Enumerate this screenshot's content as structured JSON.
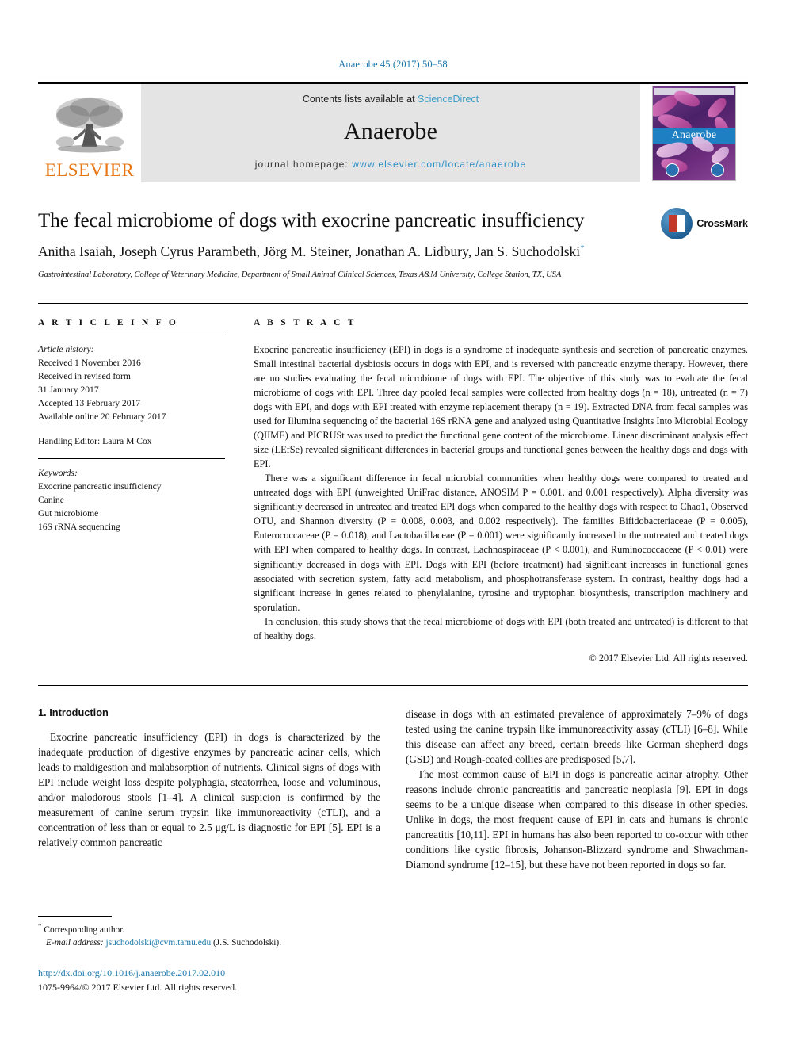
{
  "running_head": "Anaerobe 45 (2017) 50–58",
  "masthead": {
    "publisher_name": "ELSEVIER",
    "publisher_logo_icon": "elsevier-tree-icon",
    "contents_prefix": "Contents lists available at ",
    "contents_link": "ScienceDirect",
    "journal_name": "Anaerobe",
    "homepage_prefix": "journal homepage: ",
    "homepage_url": "www.elsevier.com/locate/anaerobe",
    "cover_title": "Anaerobe",
    "cover_icon": "journal-cover-image"
  },
  "title": "The fecal microbiome of dogs with exocrine pancreatic insufficiency",
  "authors": "Anitha Isaiah, Joseph Cyrus Parambeth, Jörg M. Steiner, Jonathan A. Lidbury, Jan S. Suchodolski",
  "author_marker": "*",
  "affiliation": "Gastrointestinal Laboratory, College of Veterinary Medicine, Department of Small Animal Clinical Sciences, Texas A&M University, College Station, TX, USA",
  "crossmark": {
    "label": "CrossMark",
    "icon": "crossmark-icon"
  },
  "article_info": {
    "heading": "A R T I C L E   I N F O",
    "history_label": "Article history:",
    "history": [
      "Received 1 November 2016",
      "Received in revised form",
      "31 January 2017",
      "Accepted 13 February 2017",
      "Available online 20 February 2017"
    ],
    "handling_editor": "Handling Editor: Laura M Cox",
    "keywords_label": "Keywords:",
    "keywords": [
      "Exocrine pancreatic insufficiency",
      "Canine",
      "Gut microbiome",
      "16S rRNA sequencing"
    ]
  },
  "abstract": {
    "heading": "A B S T R A C T",
    "paragraphs": [
      "Exocrine pancreatic insufficiency (EPI) in dogs is a syndrome of inadequate synthesis and secretion of pancreatic enzymes. Small intestinal bacterial dysbiosis occurs in dogs with EPI, and is reversed with pancreatic enzyme therapy. However, there are no studies evaluating the fecal microbiome of dogs with EPI. The objective of this study was to evaluate the fecal microbiome of dogs with EPI. Three day pooled fecal samples were collected from healthy dogs (n = 18), untreated (n = 7) dogs with EPI, and dogs with EPI treated with enzyme replacement therapy (n = 19). Extracted DNA from fecal samples was used for Illumina sequencing of the bacterial 16S rRNA gene and analyzed using Quantitative Insights Into Microbial Ecology (QIIME) and PICRUSt was used to predict the functional gene content of the microbiome. Linear discriminant analysis effect size (LEfSe) revealed significant differences in bacterial groups and functional genes between the healthy dogs and dogs with EPI.",
      "There was a significant difference in fecal microbial communities when healthy dogs were compared to treated and untreated dogs with EPI (unweighted UniFrac distance, ANOSIM P = 0.001, and 0.001 respectively). Alpha diversity was significantly decreased in untreated and treated EPI dogs when compared to the healthy dogs with respect to Chao1, Observed OTU, and Shannon diversity (P = 0.008, 0.003, and 0.002 respectively). The families Bifidobacteriaceae (P = 0.005), Enterococcaceae (P = 0.018), and Lactobacillaceae (P = 0.001) were significantly increased in the untreated and treated dogs with EPI when compared to healthy dogs. In contrast, Lachnospiraceae (P < 0.001), and Ruminococcaceae (P < 0.01) were significantly decreased in dogs with EPI. Dogs with EPI (before treatment) had significant increases in functional genes associated with secretion system, fatty acid metabolism, and phosphotransferase system. In contrast, healthy dogs had a significant increase in genes related to phenylalanine, tyrosine and tryptophan biosynthesis, transcription machinery and sporulation.",
      "In conclusion, this study shows that the fecal microbiome of dogs with EPI (both treated and untreated) is different to that of healthy dogs."
    ],
    "copyright": "© 2017 Elsevier Ltd. All rights reserved."
  },
  "introduction": {
    "heading": "1. Introduction",
    "col_left": [
      "Exocrine pancreatic insufficiency (EPI) in dogs is characterized by the inadequate production of digestive enzymes by pancreatic acinar cells, which leads to maldigestion and malabsorption of nutrients. Clinical signs of dogs with EPI include weight loss despite polyphagia, steatorrhea, loose and voluminous, and/or malodorous stools [1–4]. A clinical suspicion is confirmed by the measurement of canine serum trypsin like immunoreactivity (cTLI), and a concentration of less than or equal to 2.5 μg/L is diagnostic for EPI [5]. EPI is a relatively common pancreatic"
    ],
    "col_right": [
      "disease in dogs with an estimated prevalence of approximately 7–9% of dogs tested using the canine trypsin like immunoreactivity assay (cTLI) [6–8]. While this disease can affect any breed, certain breeds like German shepherd dogs (GSD) and Rough-coated collies are predisposed [5,7].",
      "The most common cause of EPI in dogs is pancreatic acinar atrophy. Other reasons include chronic pancreatitis and pancreatic neoplasia [9]. EPI in dogs seems to be a unique disease when compared to this disease in other species. Unlike in dogs, the most frequent cause of EPI in cats and humans is chronic pancreatitis [10,11]. EPI in humans has also been reported to co-occur with other conditions like cystic fibrosis, Johanson-Blizzard syndrome and Shwachman-Diamond syndrome [12–15], but these have not been reported in dogs so far."
    ]
  },
  "footnote": {
    "marker": "*",
    "corresponding": "Corresponding author.",
    "email_label": "E-mail address:",
    "email": "jsuchodolski@cvm.tamu.edu",
    "email_suffix": "(J.S. Suchodolski)."
  },
  "footer": {
    "doi": "http://dx.doi.org/10.1016/j.anaerobe.2017.02.010",
    "issn_line": "1075-9964/© 2017 Elsevier Ltd. All rights reserved."
  },
  "colors": {
    "link_blue": "#1b77ab",
    "sciencedirect_blue": "#3a9ec9",
    "elsevier_orange": "#e87511",
    "masthead_gray": "#e4e4e4"
  }
}
